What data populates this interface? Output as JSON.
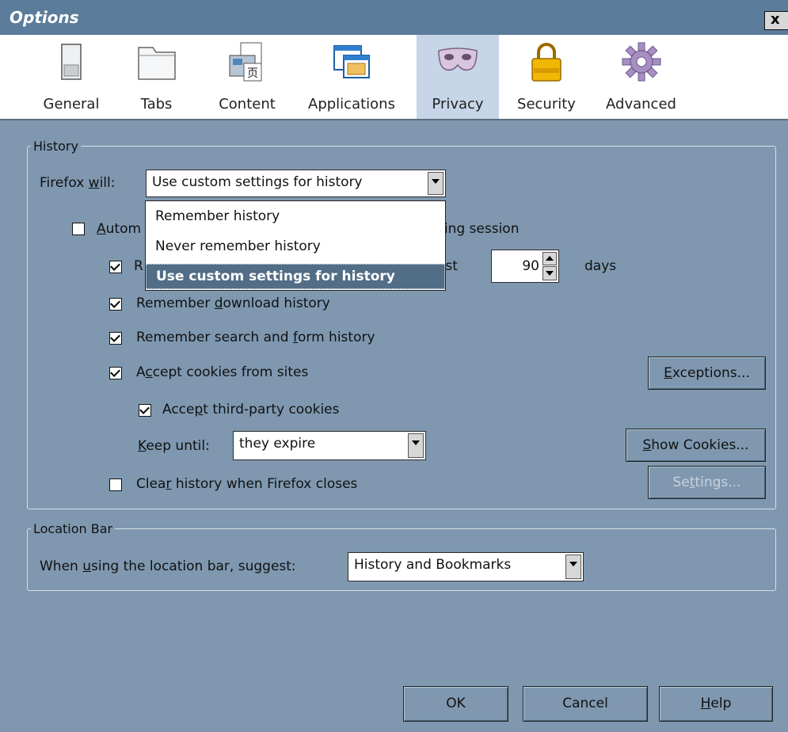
{
  "window": {
    "title": "Options",
    "close_glyph": "x"
  },
  "toolbar": {
    "panes": [
      {
        "label": "General",
        "icon": "general-switch-icon",
        "selected": false
      },
      {
        "label": "Tabs",
        "icon": "tabs-folder-icon",
        "selected": false
      },
      {
        "label": "Content",
        "icon": "content-page-icon",
        "selected": false
      },
      {
        "label": "Applications",
        "icon": "applications-window-icon",
        "selected": false
      },
      {
        "label": "Privacy",
        "icon": "privacy-mask-icon",
        "selected": true
      },
      {
        "label": "Security",
        "icon": "security-padlock-icon",
        "selected": false
      },
      {
        "label": "Advanced",
        "icon": "advanced-gear-icon",
        "selected": false
      }
    ]
  },
  "history": {
    "legend": "History",
    "firefox_will": {
      "pre": "Firefox ",
      "accesskey": "w",
      "post": "ill:"
    },
    "mode_value": "Use custom settings for history",
    "dropdown_options": [
      {
        "label": "Remember history",
        "selected": false
      },
      {
        "label": "Never remember history",
        "selected": false
      },
      {
        "label": "Use custom settings for history",
        "selected": true
      }
    ],
    "auto_private": {
      "checked": false,
      "left_accesskey": "A",
      "left_rest": "utom",
      "right_text": "sing session"
    },
    "browse": {
      "checked": true,
      "left_text": "R",
      "right_text": "ast",
      "days_value": "90",
      "days_unit": "days"
    },
    "download": {
      "checked": true,
      "pre": "Remember ",
      "accesskey": "d",
      "post": "ownload history"
    },
    "search_form": {
      "checked": true,
      "pre": "Remember search and ",
      "accesskey": "f",
      "post": "orm history"
    },
    "cookies": {
      "checked": true,
      "pre": "A",
      "accesskey": "c",
      "post": "cept cookies from sites"
    },
    "exceptions_button": {
      "accesskey": "E",
      "rest": "xceptions..."
    },
    "third_party": {
      "checked": true,
      "pre": "Acce",
      "accesskey": "p",
      "post": "t third-party cookies"
    },
    "keep_until": {
      "accesskey": "K",
      "rest": "eep until:",
      "value": "they expire"
    },
    "show_cookies_button": {
      "accesskey": "S",
      "rest": "how Cookies..."
    },
    "clear_on_close": {
      "checked": false,
      "pre": "Clea",
      "accesskey": "r",
      "post": " history when Firefox closes"
    },
    "settings_button": {
      "pre": "Se",
      "accesskey": "t",
      "post": "tings..."
    }
  },
  "location_bar": {
    "legend": "Location Bar",
    "label": {
      "pre": "When ",
      "accesskey": "u",
      "post": "sing the location bar, suggest:"
    },
    "suggest_value": "History and Bookmarks"
  },
  "footer": {
    "ok_label": "OK",
    "cancel_label": "Cancel",
    "help": {
      "accesskey": "H",
      "rest": "elp"
    }
  }
}
